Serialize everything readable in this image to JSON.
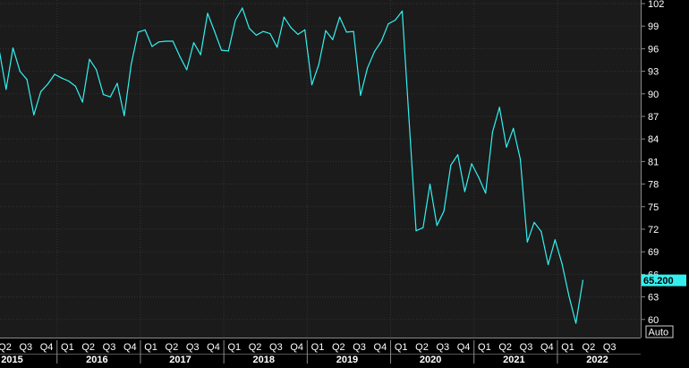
{
  "chart_data": {
    "type": "line",
    "title": "",
    "xlabel": "",
    "ylabel": "",
    "ylim": [
      58.4,
      103.6
    ],
    "yticks": [
      "102",
      "99",
      "96",
      "93",
      "90",
      "87",
      "84",
      "81",
      "78",
      "75",
      "72",
      "69",
      "66",
      "63",
      "60"
    ],
    "quarter_labels": [
      "Q2",
      "Q3",
      "Q4",
      "Q1",
      "Q2",
      "Q3",
      "Q4",
      "Q1",
      "Q2",
      "Q3",
      "Q4",
      "Q1",
      "Q2",
      "Q3",
      "Q4",
      "Q1",
      "Q2",
      "Q3",
      "Q4",
      "Q1",
      "Q2",
      "Q3",
      "Q4",
      "Q1",
      "Q2",
      "Q3",
      "Q4",
      "Q1",
      "Q2",
      "Q3"
    ],
    "year_labels": [
      "2015",
      "2016",
      "2017",
      "2018",
      "2019",
      "2020",
      "2021",
      "2022"
    ],
    "last_value_label": "65.200",
    "auto_label": "Auto",
    "grid": true,
    "colors": {
      "line": "#33f0f0",
      "background": "#000000",
      "plot_background": "#1b1b1b",
      "grid": "#333333",
      "badge": "#33f0f0",
      "text": "#ffffff"
    },
    "series": [
      {
        "values": [
          95.9,
          90.6,
          96.1,
          93.0,
          91.9,
          87.2,
          90.3,
          91.3,
          92.6,
          92.1,
          91.7,
          91.0,
          88.9,
          94.6,
          93.2,
          89.9,
          89.6,
          91.4,
          87.1,
          93.9,
          98.2,
          98.5,
          96.3,
          96.9,
          97.0,
          97.0,
          95.0,
          93.2,
          96.8,
          95.2,
          100.7,
          98.3,
          95.8,
          95.7,
          99.8,
          101.4,
          98.7,
          97.8,
          98.3,
          98.0,
          96.2,
          100.2,
          98.8,
          97.9,
          98.5,
          91.2,
          93.9,
          98.4,
          97.2,
          100.2,
          98.2,
          98.3,
          89.8,
          93.4,
          95.6,
          97.0,
          99.3,
          99.8,
          101.0,
          86.4,
          71.8,
          72.2,
          78.0,
          72.5,
          74.4,
          80.5,
          81.9,
          77.0,
          80.7,
          78.9,
          76.8,
          84.9,
          88.2,
          82.9,
          85.4,
          81.3,
          70.3,
          72.9,
          71.7,
          67.3,
          70.6,
          67.4,
          63.1,
          59.5,
          65.2
        ]
      }
    ]
  }
}
